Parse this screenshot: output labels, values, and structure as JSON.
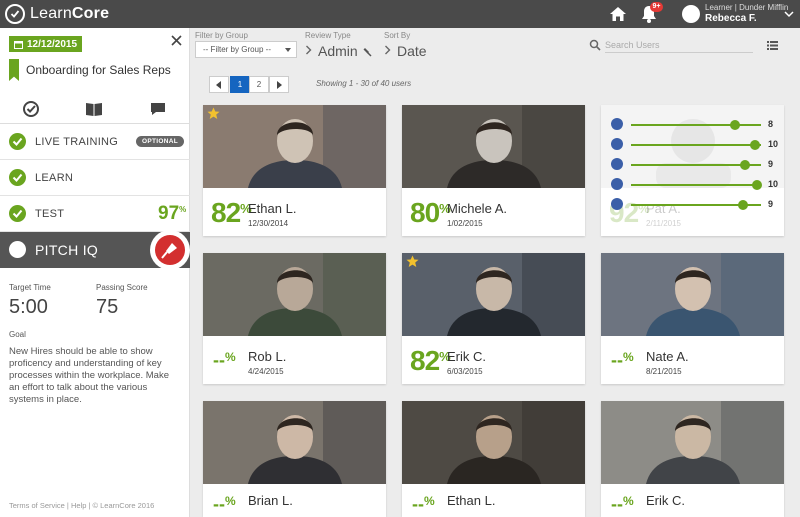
{
  "app": {
    "brand_prefix": "Learn",
    "brand_suffix": "Core"
  },
  "header": {
    "notification_count": "9+",
    "user_role": "Learner  | Dunder Mifflin",
    "user_name": "Rebecca F."
  },
  "sidebar": {
    "date": "12/12/2015",
    "course_title": "Onboarding for Sales Reps",
    "steps": [
      {
        "label": "LIVE TRAINING",
        "badge": "OPTIONAL"
      },
      {
        "label": "LEARN"
      },
      {
        "label": "TEST",
        "score": "97",
        "score_unit": "%"
      },
      {
        "label": "PITCH IQ"
      }
    ],
    "target_time_label": "Target Time",
    "target_time": "5:00",
    "passing_score_label": "Passing Score",
    "passing_score": "75",
    "goal_label": "Goal",
    "goal_text": "New Hires should be able to show proficency and understanding of key processes within the workplace. Make an effort to talk about the various systems in place.",
    "footer": "Terms of Service | Help | © LearnCore 2016"
  },
  "filters": {
    "group_label": "Filter by Group",
    "group_value": "-- Filter by Group --",
    "review_label": "Review Type",
    "review_value": "Admin",
    "sort_label": "Sort By",
    "sort_value": "Date",
    "search_placeholder": "Search Users"
  },
  "pagination": {
    "pages": [
      "1",
      "2"
    ],
    "current": "1",
    "showing": "Showing 1 - 30 of 40 users"
  },
  "cards": [
    {
      "name": "Ethan L.",
      "date": "12/30/2014",
      "score": "82",
      "unit": "%",
      "starred": true
    },
    {
      "name": "Michele A.",
      "date": "1/02/2015",
      "score": "80",
      "unit": "%",
      "starred": false
    },
    {
      "name": "Pat A.",
      "date": "2/11/2015",
      "score": "92",
      "unit": "%",
      "starred": false,
      "skills": [
        {
          "icon": "award-icon",
          "value": "8",
          "level": 0.8
        },
        {
          "icon": "lightbulb-icon",
          "value": "10",
          "level": 0.95
        },
        {
          "icon": "shield-icon",
          "value": "9",
          "level": 0.88
        },
        {
          "icon": "smile-icon",
          "value": "10",
          "level": 0.97
        },
        {
          "icon": "target-icon",
          "value": "9",
          "level": 0.86
        }
      ]
    },
    {
      "name": "Rob L.",
      "date": "4/24/2015",
      "score": "--",
      "unit": "%",
      "starred": false
    },
    {
      "name": "Erik C.",
      "date": "6/03/2015",
      "score": "82",
      "unit": "%",
      "starred": true
    },
    {
      "name": "Nate A.",
      "date": "8/21/2015",
      "score": "--",
      "unit": "%",
      "starred": false
    },
    {
      "name": "Brian L.",
      "date": "",
      "score": "--",
      "unit": "%",
      "starred": false
    },
    {
      "name": "Ethan L.",
      "date": "",
      "score": "--",
      "unit": "%",
      "starred": false
    },
    {
      "name": "Erik C.",
      "date": "",
      "score": "--",
      "unit": "%",
      "starred": false
    }
  ],
  "colors": {
    "accent": "#6aa51f",
    "topbar": "#4a4a4a",
    "primary": "#1565c0",
    "danger": "#d32f2f"
  }
}
